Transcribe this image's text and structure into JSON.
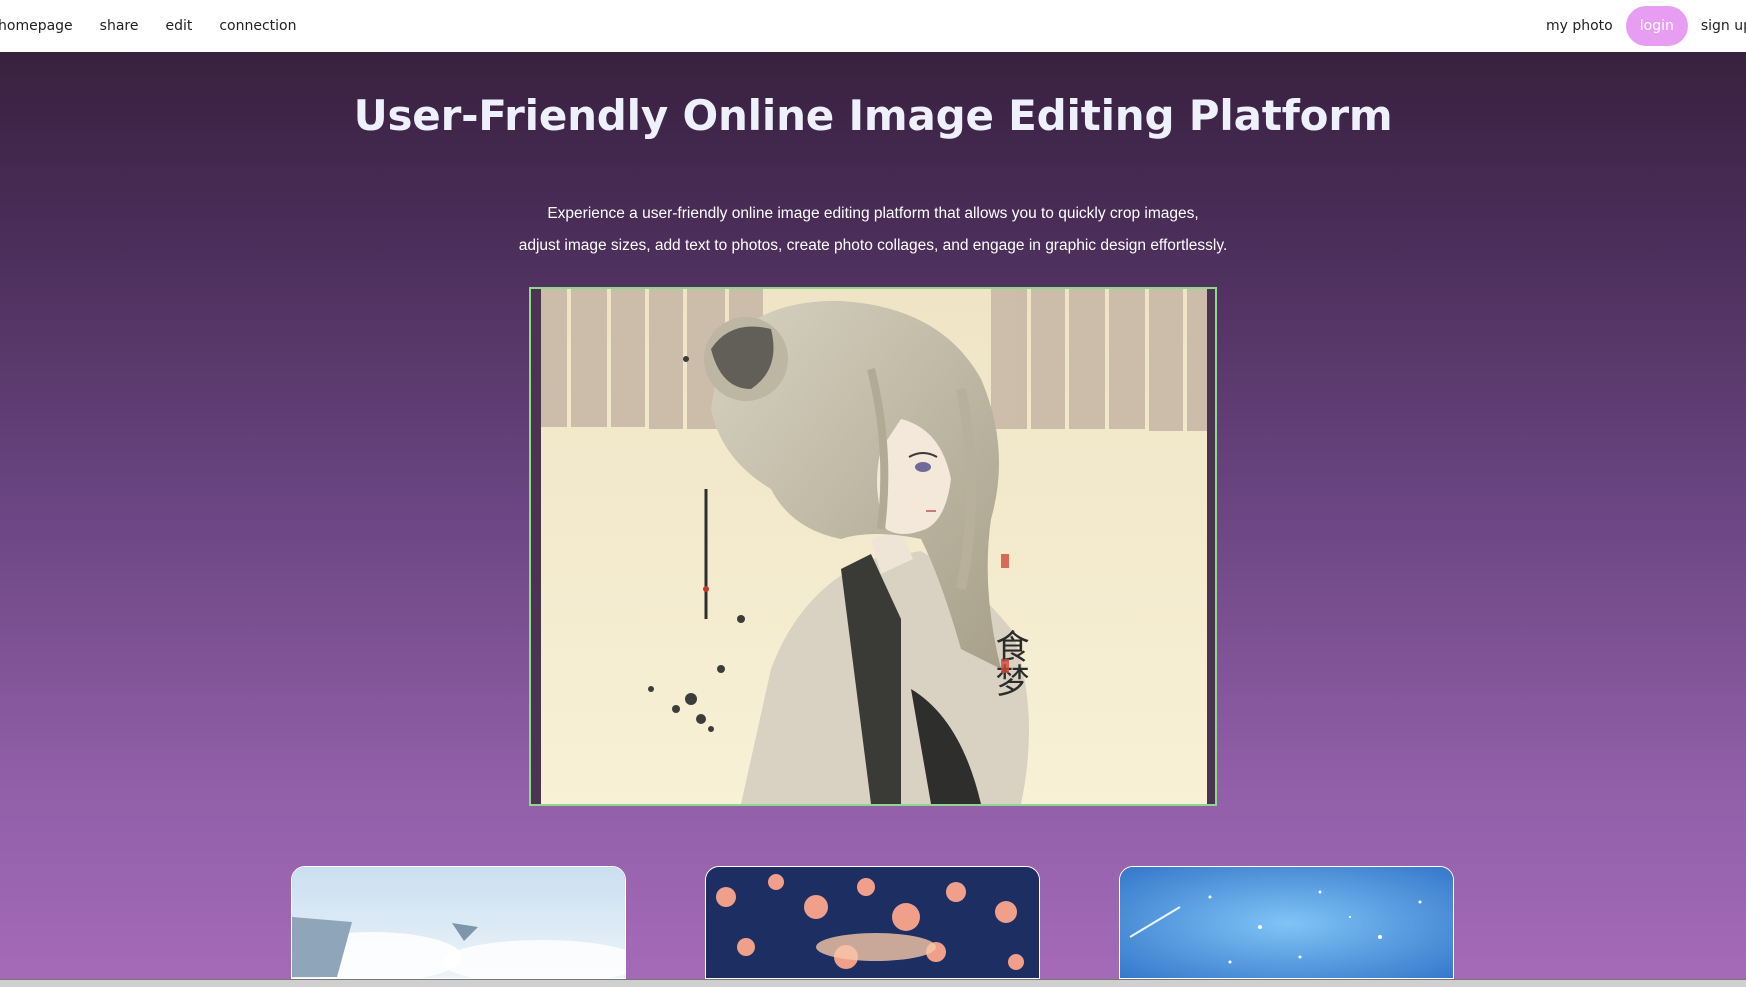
{
  "nav": {
    "left_links": [
      "homepage",
      "share",
      "edit",
      "connection"
    ],
    "my_photo": "my photo",
    "login": "login",
    "signup": "sign up"
  },
  "hero": {
    "title": "User-Friendly Online Image Editing Platform",
    "description_line1": "Experience a user-friendly online image editing platform that allows you to quickly crop images,",
    "description_line2": "adjust image sizes, add text to photos, create photo collages, and engage in graphic design effortlessly."
  },
  "featured_image": {
    "subject": "anime-girl-illustration",
    "calligraphy": "食梦"
  },
  "gallery": [
    "sky-islands",
    "cherry-blossom-night",
    "starry-galaxy"
  ],
  "colors": {
    "login_button": "#e79ef2",
    "frame_border": "#8ed88a",
    "gradient_top": "#38213f",
    "gradient_bottom": "#a46ab8"
  }
}
